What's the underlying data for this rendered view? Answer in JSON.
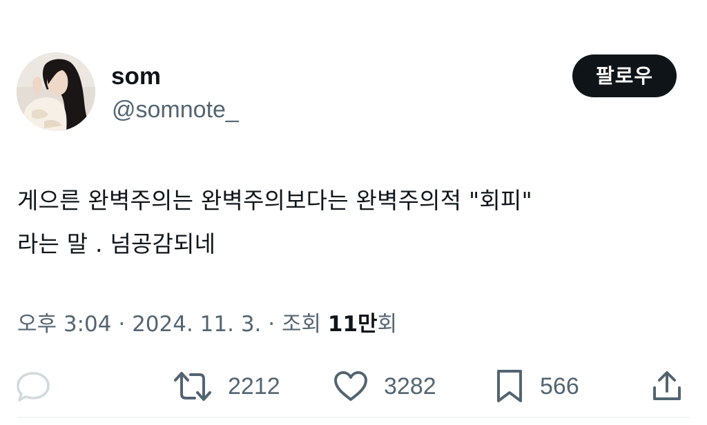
{
  "author": {
    "display_name": "som",
    "handle": "@somnote_"
  },
  "follow_button": {
    "label": "팔로우"
  },
  "post": {
    "text_line_1": "게으른 완벽주의는 완벽주의보다는 완벽주의적 \"회피\"",
    "text_line_2": "라는 말 . 넘공감되네"
  },
  "meta": {
    "time": "오후 3:04",
    "separator": " · ",
    "date": "2024. 11. 3.",
    "views_label": "조회 ",
    "views_count": "11만",
    "views_suffix": "회"
  },
  "actions": {
    "retweets": "2212",
    "likes": "3282",
    "bookmarks": "566"
  },
  "icons": {
    "back": "chevron-left-icon",
    "reply": "speech-bubble-icon",
    "retweet": "retweet-icon",
    "like": "heart-icon",
    "bookmark": "bookmark-icon",
    "share": "share-upload-icon"
  },
  "colors": {
    "text_primary": "#0f1419",
    "text_secondary": "#536471",
    "button_bg": "#0f1419",
    "button_text": "#ffffff",
    "reply_icon": "#cfd9de"
  }
}
